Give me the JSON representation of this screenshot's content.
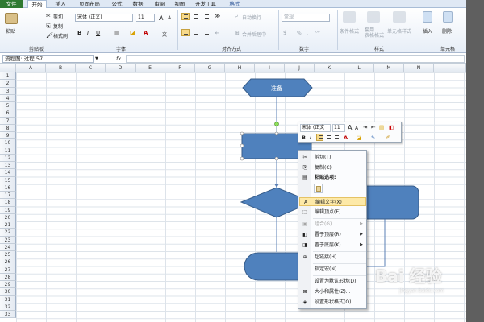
{
  "tabs": [
    "文件",
    "开始",
    "插入",
    "页面布局",
    "公式",
    "数据",
    "审阅",
    "视图",
    "开发工具",
    "格式"
  ],
  "ribbon": {
    "clipboard": {
      "paste": "粘贴",
      "cut": "剪切",
      "copy": "复制",
      "format_painter": "格式刷",
      "group": "剪贴板"
    },
    "font": {
      "name": "宋体 (正文)",
      "size": "11",
      "bold": "B",
      "italic": "I",
      "underline": "U",
      "grow": "A",
      "shrink": "A",
      "group": "字体",
      "wen": "文"
    },
    "alignment": {
      "wrap": "自动换行",
      "merge": "合并后居中",
      "group": "对齐方式"
    },
    "number": {
      "format": "常规",
      "percent": "%",
      "comma": ",",
      "group": "数字"
    },
    "styles": {
      "conditional": "条件格式",
      "table": "套用\n表格格式",
      "cell": "单元格样式",
      "group": "样式"
    },
    "cells": {
      "insert": "插入",
      "delete": "删除",
      "group": "单元格"
    }
  },
  "formula_bar": {
    "name_box": "流程图: 过程 57",
    "fx": "fx"
  },
  "columns": [
    "A",
    "B",
    "C",
    "D",
    "E",
    "F",
    "G",
    "H",
    "I",
    "J",
    "K",
    "L",
    "M",
    "N"
  ],
  "rows": [
    "1",
    "2",
    "3",
    "4",
    "5",
    "6",
    "7",
    "8",
    "9",
    "10",
    "11",
    "12",
    "13",
    "14",
    "15",
    "16",
    "17",
    "18",
    "19",
    "20",
    "21",
    "22",
    "23",
    "24",
    "25",
    "26",
    "27",
    "28",
    "29",
    "30",
    "31",
    "32",
    "33"
  ],
  "shapes": {
    "prepare_label": "准备"
  },
  "mini_toolbar": {
    "font": "宋体 (正文",
    "size": "11",
    "bold": "B",
    "italic": "I",
    "font_color": "A"
  },
  "context_menu": {
    "items": [
      {
        "label": "剪切(T)",
        "icon": "scissors-icon",
        "glyph": "✂"
      },
      {
        "label": "复制(C)",
        "icon": "copy-icon",
        "glyph": "⎘"
      },
      {
        "label": "粘贴选项:",
        "icon": "paste-icon",
        "glyph": "📋"
      },
      {
        "label": "编辑文字(X)",
        "icon": "edit-text-icon",
        "glyph": "A"
      },
      {
        "label": "编辑顶点(E)",
        "icon": "edit-points-icon",
        "glyph": "⬚"
      },
      {
        "label": "组合(G)",
        "icon": "group-icon",
        "glyph": "▣"
      },
      {
        "label": "置于顶层(R)",
        "icon": "bring-front-icon",
        "glyph": "◧"
      },
      {
        "label": "置于底层(K)",
        "icon": "send-back-icon",
        "glyph": "◨"
      },
      {
        "label": "超链接(H)...",
        "icon": "hyperlink-icon",
        "glyph": "🌐"
      },
      {
        "label": "指定宏(N)...",
        "icon": "",
        "glyph": ""
      },
      {
        "label": "设置为默认形状(D)",
        "icon": "",
        "glyph": ""
      },
      {
        "label": "大小和属性(Z)...",
        "icon": "size-icon",
        "glyph": "⊞"
      },
      {
        "label": "设置形状格式(O)...",
        "icon": "format-shape-icon",
        "glyph": "◈"
      }
    ]
  },
  "watermark": {
    "text": "Bai 经验",
    "url": "jingyan.baidu.com"
  },
  "colors": {
    "shape_fill": "#4f81bd",
    "shape_stroke": "#385d8a",
    "file_tab": "#2f7a32",
    "menu_highlight": "#fde9a8"
  }
}
